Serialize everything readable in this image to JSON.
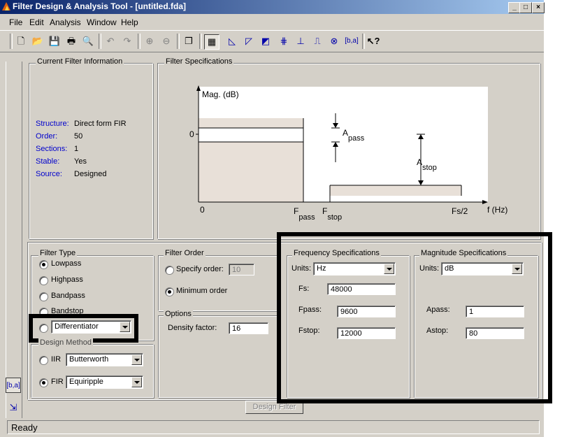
{
  "window": {
    "title": "Filter Design & Analysis Tool - [untitled.fda]"
  },
  "titlebar_buttons": {
    "minimize": "_",
    "maximize": "□",
    "close": "×"
  },
  "menu": [
    "File",
    "Edit",
    "Analysis",
    "Window",
    "Help"
  ],
  "toolbar_icons": [
    "new-icon",
    "open-icon",
    "save-icon",
    "print-icon",
    "print-preview-icon",
    "undo-icon",
    "redo-icon",
    "zoom-in-icon",
    "zoom-out-icon",
    "new-window-icon",
    "filter-specs-icon",
    "magnitude-response-icon",
    "phase-response-icon",
    "magnitude-phase-icon",
    "group-delay-icon",
    "impulse-response-icon",
    "step-response-icon",
    "pole-zero-icon",
    "filter-coefficients-icon",
    "whats-this-icon"
  ],
  "current_filter": {
    "legend": "Current Filter Information",
    "structure_label": "Structure:",
    "structure": "Direct form FIR",
    "order_label": "Order:",
    "order": "50",
    "sections_label": "Sections:",
    "sections": "1",
    "stable_label": "Stable:",
    "stable": "Yes",
    "source_label": "Source:",
    "source": "Designed"
  },
  "filter_specs": {
    "legend": "Filter Specifications",
    "ylabel": "Mag. (dB)",
    "zero_y": "0",
    "zero_x": "0",
    "fpass": "F",
    "fpass_sub": "pass",
    "fstop": "F",
    "fstop_sub": "stop",
    "fs2": "Fs/2",
    "xlabel": "f (Hz)",
    "apass": "A",
    "apass_sub": "pass",
    "astop": "A",
    "astop_sub": "stop"
  },
  "filter_type": {
    "legend": "Filter Type",
    "options": [
      "Lowpass",
      "Highpass",
      "Bandpass",
      "Bandstop"
    ],
    "selected": "Lowpass",
    "other_value": "Differentiator"
  },
  "design_method": {
    "legend": "Design Method",
    "iir_label": "IIR",
    "iir_value": "Butterworth",
    "fir_label": "FIR",
    "fir_value": "Equiripple",
    "selected": "FIR"
  },
  "filter_order": {
    "legend": "Filter Order",
    "specify_label": "Specify order:",
    "specify_value": "10",
    "minimum_label": "Minimum order",
    "selected": "Minimum order"
  },
  "options": {
    "legend": "Options",
    "density_label": "Density factor:",
    "density_value": "16"
  },
  "frequency_specs": {
    "legend": "Frequency Specifications",
    "units_label": "Units:",
    "units": "Hz",
    "fs_label": "Fs:",
    "fs": "48000",
    "fpass_label": "Fpass:",
    "fpass": "9600",
    "fstop_label": "Fstop:",
    "fstop": "12000"
  },
  "magnitude_specs": {
    "legend": "Magnitude Specifications",
    "units_label": "Units:",
    "units": "dB",
    "apass_label": "Apass:",
    "apass": "1",
    "astop_label": "Astop:",
    "astop": "80"
  },
  "design_button": "Design Filter",
  "status": "Ready"
}
